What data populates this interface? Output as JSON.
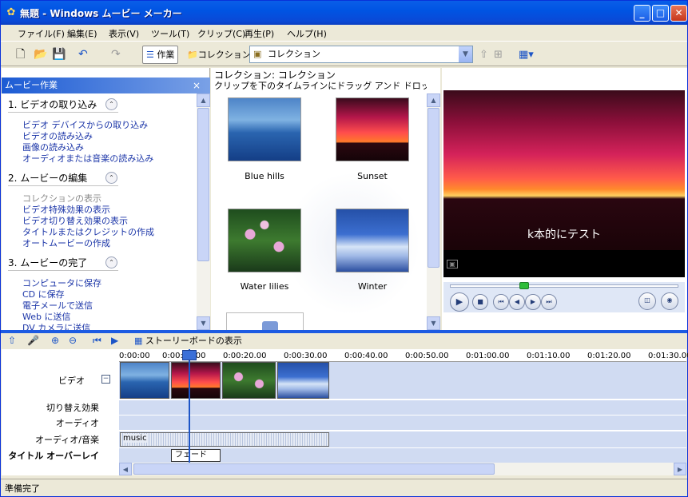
{
  "window": {
    "title": "無題 - Windows ムービー メーカー",
    "controls": {
      "minimize": "_",
      "maximize": "□",
      "close": "✕"
    }
  },
  "menu": [
    "ファイル(F)",
    "編集(E)",
    "表示(V)",
    "ツール(T)",
    "クリップ(C)",
    "再生(P)",
    "ヘルプ(H)"
  ],
  "toolbar": {
    "tasks_label": "作業",
    "collections_label": "コレクション",
    "collection_select": "コレクション"
  },
  "tasks_pane": {
    "header": "ムービー作業",
    "close": "×",
    "sections": [
      {
        "title": "1. ビデオの取り込み",
        "links": [
          "ビデオ デバイスからの取り込み",
          "ビデオの読み込み",
          "画像の読み込み",
          "オーディオまたは音楽の読み込み"
        ]
      },
      {
        "title": "2. ムービーの編集",
        "links": [
          "コレクションの表示",
          "ビデオ特殊効果の表示",
          "ビデオ切り替え効果の表示",
          "タイトルまたはクレジットの作成",
          "オートムービーの作成"
        ]
      },
      {
        "title": "3. ムービーの完了",
        "links": [
          "コンピュータに保存",
          "CD に保存",
          "電子メールで送信",
          "Web に送信",
          "DV カメラに送信"
        ]
      }
    ]
  },
  "collection": {
    "heading": "コレクション: コレクション",
    "subheading": "クリップを下のタイムラインにドラッグ アンド ドロップしてください。",
    "clips": [
      "Blue hills",
      "Sunset",
      "Water lilies",
      "Winter"
    ]
  },
  "preview": {
    "subtitle": "k本的にテスト"
  },
  "timeline": {
    "storyboard_label": "ストーリーボードの表示",
    "ticks": [
      "0:00:00",
      "0:00:10.00",
      "0:00:20.00",
      "0:00:30.00",
      "0:00:40.00",
      "0:00:50.00",
      "0:01:00.00",
      "0:01:10.00",
      "0:01:20.00",
      "0:01:30.00"
    ],
    "tracks": {
      "video": "ビデオ",
      "transition": "切り替え効果",
      "audio": "オーディオ",
      "audio_music": "オーディオ/音楽",
      "title_overlay": "タイトル オーバーレイ"
    },
    "music_clip": "music",
    "title_clip": "フェード"
  },
  "status": "準備完了",
  "colors": {
    "titlebar": "#0054e3",
    "link": "#1c36a8",
    "track": "#d0dbf2"
  }
}
